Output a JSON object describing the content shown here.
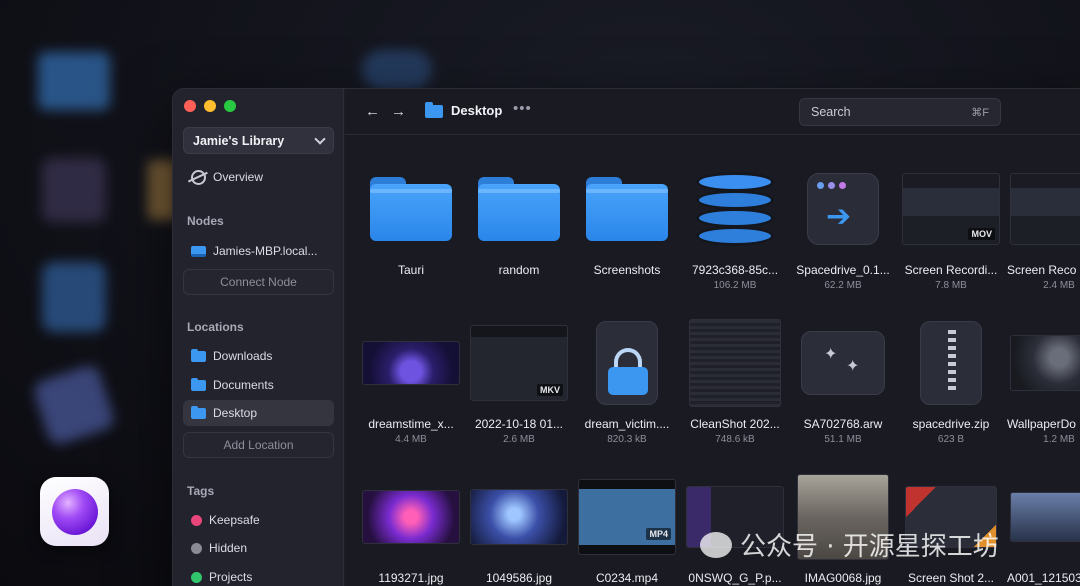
{
  "sidebar": {
    "library": "Jamie's Library",
    "overview": "Overview",
    "nodes_heading": "Nodes",
    "node_name": "Jamies-MBP.local...",
    "connect_node": "Connect Node",
    "locations_heading": "Locations",
    "locations": [
      "Downloads",
      "Documents",
      "Desktop"
    ],
    "add_location": "Add Location",
    "tags_heading": "Tags",
    "tags": [
      {
        "label": "Keepsafe",
        "color": "#e8467a"
      },
      {
        "label": "Hidden",
        "color": "#8a8b95"
      },
      {
        "label": "Projects",
        "color": "#31c66b"
      }
    ]
  },
  "topbar": {
    "back_icon": "arrow-left-icon",
    "forward_icon": "arrow-right-icon",
    "location": "Desktop",
    "more": "•••",
    "search_placeholder": "Search",
    "search_shortcut": "⌘F"
  },
  "files": {
    "row1": [
      {
        "name": "Tauri",
        "size": ""
      },
      {
        "name": "random",
        "size": ""
      },
      {
        "name": "Screenshots",
        "size": ""
      },
      {
        "name": "7923c368-85c...",
        "size": "106.2 MB"
      },
      {
        "name": "Spacedrive_0.1...",
        "size": "62.2 MB"
      },
      {
        "name": "Screen Recordi...",
        "size": "7.8 MB",
        "badge": "MOV"
      },
      {
        "name": "Screen Reco",
        "size": "2.4 MB"
      }
    ],
    "row2": [
      {
        "name": "dreamstime_x...",
        "size": "4.4 MB"
      },
      {
        "name": "2022-10-18 01...",
        "size": "2.6 MB",
        "badge": "MKV"
      },
      {
        "name": "dream_victim....",
        "size": "820.3 kB"
      },
      {
        "name": "CleanShot 202...",
        "size": "748.6 kB"
      },
      {
        "name": "SA702768.arw",
        "size": "51.1 MB"
      },
      {
        "name": "spacedrive.zip",
        "size": "623 B"
      },
      {
        "name": "WallpaperDo",
        "size": "1.2 MB"
      }
    ],
    "row3": [
      {
        "name": "1193271.jpg"
      },
      {
        "name": "1049586.jpg"
      },
      {
        "name": "C0234.mp4",
        "badge": "MP4"
      },
      {
        "name": "0NSWQ_G_P.p..."
      },
      {
        "name": "IMAG0068.jpg"
      },
      {
        "name": "Screen Shot 2..."
      },
      {
        "name": "A001_121503"
      }
    ]
  },
  "watermark": "公众号 · 开源星探工坊",
  "colors": {
    "accent": "#3b97f0",
    "window_bg": "#1c1d25",
    "sidebar_bg": "#22232d"
  }
}
